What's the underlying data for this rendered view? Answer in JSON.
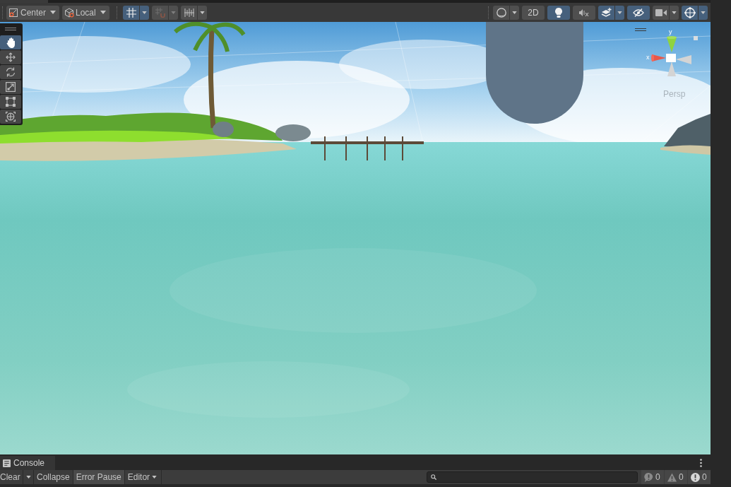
{
  "scene_toolbar": {
    "pivot": {
      "label": "Center"
    },
    "space": {
      "label": "Local"
    },
    "snap_toggles": [
      {
        "kind": "grid-snap",
        "on": true,
        "dropdown": true,
        "disabled": false
      },
      {
        "kind": "increment-snap",
        "on": false,
        "dropdown": true,
        "disabled": true
      },
      {
        "kind": "grid",
        "on": false,
        "dropdown": true,
        "disabled": false
      }
    ],
    "view_toggles": [
      {
        "kind": "shading",
        "on": false,
        "dropdown": true
      },
      {
        "kind": "mode",
        "label": "2D",
        "on": false,
        "dropdown": false
      },
      {
        "kind": "lighting",
        "on": true,
        "dropdown": false
      },
      {
        "kind": "audio",
        "on": false,
        "dropdown": false
      },
      {
        "kind": "effects",
        "on": true,
        "dropdown": true
      },
      {
        "kind": "visibility",
        "on": true,
        "dropdown": false
      },
      {
        "kind": "camera",
        "on": false,
        "dropdown": true
      },
      {
        "kind": "gizmos",
        "on": true,
        "dropdown": true
      }
    ]
  },
  "scene_view": {
    "tools": [
      {
        "kind": "hand",
        "selected": true
      },
      {
        "kind": "move",
        "selected": false
      },
      {
        "kind": "rotate",
        "selected": false
      },
      {
        "kind": "scale",
        "selected": false
      },
      {
        "kind": "rect",
        "selected": false
      },
      {
        "kind": "transform",
        "selected": false
      }
    ],
    "gizmo": {
      "y_label": "y",
      "x_label": "x",
      "projection": "Persp"
    }
  },
  "console": {
    "tab": {
      "label": "Console"
    },
    "clear": {
      "label": "Clear"
    },
    "toggles": [
      {
        "label": "Collapse",
        "on": false
      },
      {
        "label": "Error Pause",
        "on": true
      }
    ],
    "log_filter": {
      "label": "Editor"
    },
    "counters": [
      {
        "kind": "info",
        "count": "0"
      },
      {
        "kind": "warning",
        "count": "0"
      },
      {
        "kind": "error",
        "count": "0"
      }
    ]
  }
}
